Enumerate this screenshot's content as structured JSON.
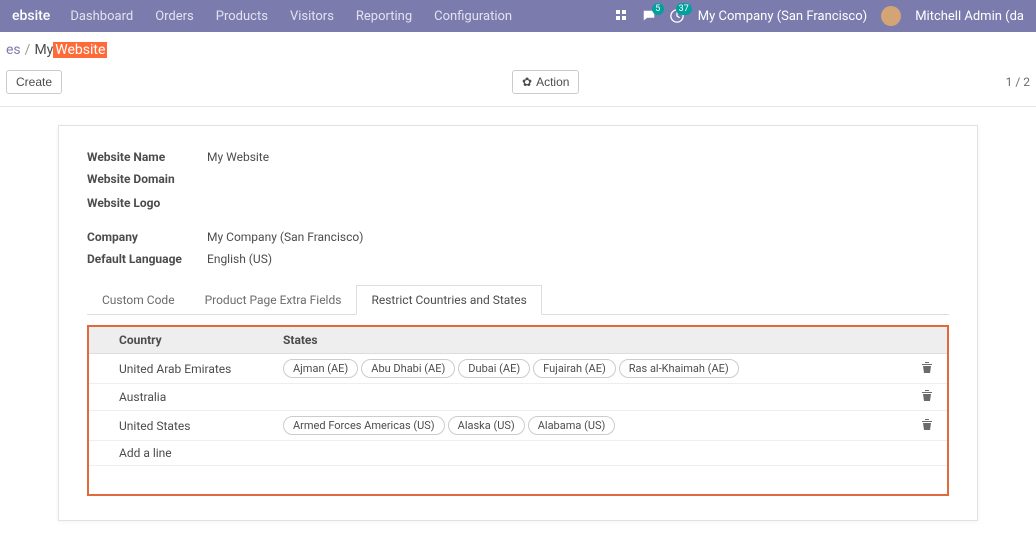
{
  "topbar": {
    "brand": "ebsite",
    "nav": [
      "Dashboard",
      "Orders",
      "Products",
      "Visitors",
      "Reporting",
      "Configuration"
    ],
    "chat_badge": "5",
    "clock_badge": "37",
    "company": "My Company (San Francisco)",
    "user": "Mitchell Admin (da"
  },
  "breadcrumb": {
    "root": "es",
    "current_prefix": "My ",
    "current_highlight": "Website"
  },
  "actions": {
    "create": "Create",
    "action": "Action"
  },
  "pager": "1 / 2",
  "form": {
    "fields": {
      "website_name_label": "Website Name",
      "website_name_value": "My Website",
      "website_domain_label": "Website Domain",
      "website_domain_value": "",
      "website_logo_label": "Website Logo",
      "company_label": "Company",
      "company_value": "My Company (San Francisco)",
      "default_lang_label": "Default Language",
      "default_lang_value": "English (US)"
    },
    "tabs": [
      "Custom Code",
      "Product Page Extra Fields",
      "Restrict Countries and States"
    ],
    "active_tab": 2,
    "table": {
      "headers": {
        "country": "Country",
        "states": "States"
      },
      "rows": [
        {
          "country": "United Arab Emirates",
          "states": [
            "Ajman (AE)",
            "Abu Dhabi (AE)",
            "Dubai (AE)",
            "Fujairah (AE)",
            "Ras al-Khaimah (AE)"
          ]
        },
        {
          "country": "Australia",
          "states": []
        },
        {
          "country": "United States",
          "states": [
            "Armed Forces Americas (US)",
            "Alaska (US)",
            "Alabama (US)"
          ]
        }
      ],
      "add_line": "Add a line"
    }
  }
}
